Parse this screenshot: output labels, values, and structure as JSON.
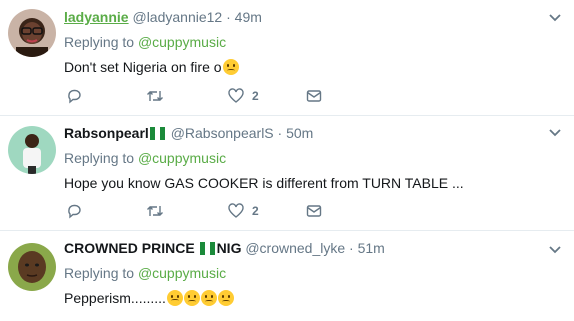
{
  "tweets": [
    {
      "display_name": "ladyannie",
      "handle": "@ladyannie12",
      "separator": "·",
      "time": "49m",
      "replying_prefix": "Replying to",
      "replying_to": "@cuppymusic",
      "text": "Don't set Nigeria on fire o",
      "emojis": [
        "weary-face"
      ],
      "like_count": "2"
    },
    {
      "display_name": "Rabsonpearl",
      "handle": "@RabsonpearlS",
      "separator": "·",
      "time": "50m",
      "replying_prefix": "Replying to",
      "replying_to": "@cuppymusic",
      "text": "Hope you know GAS COOKER is different from TURN TABLE ...",
      "like_count": "2"
    },
    {
      "display_name_part1": "CROWNED PRINCE",
      "display_name_part2": "NIG",
      "handle": "@crowned_lyke",
      "separator": "·",
      "time": "51m",
      "replying_prefix": "Replying to",
      "replying_to": "@cuppymusic",
      "text": "Pepperism.........",
      "emojis": [
        "frowning-face",
        "frowning-face",
        "frowning-face",
        "frowning-face"
      ]
    }
  ],
  "colors": {
    "link_green": "#5aac47",
    "muted": "#657786",
    "text": "#14171a",
    "divider": "#e6ecf0",
    "flag_green": "#1b8a3a"
  },
  "icons": [
    "reply-icon",
    "retweet-icon",
    "like-icon",
    "direct-message-icon",
    "chevron-down-icon",
    "nigeria-flag-icon"
  ]
}
